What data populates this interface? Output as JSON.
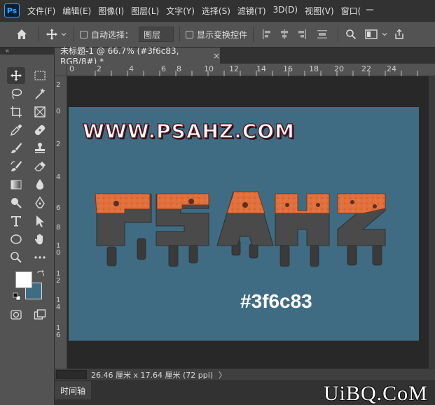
{
  "app": {
    "logo": "Ps"
  },
  "menubar": {
    "items": [
      "文件(F)",
      "编辑(E)",
      "图像(I)",
      "图层(L)",
      "文字(Y)",
      "选择(S)",
      "滤镜(T)",
      "3D(D)",
      "视图(V)",
      "窗口("
    ]
  },
  "options": {
    "auto_select_label": "自动选择：",
    "layer_select_value": "图层",
    "show_transform_label": "显示变换控件"
  },
  "panel_collapse": "«",
  "document": {
    "tab_title": "未标题-1 @ 66.7% (#3f6c83, RGB/8#) *",
    "close_glyph": "×"
  },
  "rulers": {
    "horizontal": [
      "0",
      "2",
      "4",
      "6",
      "8",
      "10",
      "12",
      "14",
      "16",
      "18",
      "20",
      "22",
      "24"
    ],
    "vertical": [
      "2",
      "0",
      "2",
      "4",
      "6",
      "8",
      "1\n0",
      "1\n2",
      "1\n4",
      "1\n6"
    ]
  },
  "canvas": {
    "background_color": "#3f6c83",
    "url_text": "WWW.PSAHZ.COM",
    "art_letters": "PSAHZ",
    "color_label": "#3f6c83"
  },
  "status": {
    "doc_size": "26.46 厘米 x 17.64 厘米 (72 ppi)",
    "arrow": "〉"
  },
  "timeline": {
    "label": "时间轴"
  },
  "watermark": "UiBQ.CoM",
  "icons": {
    "home": "home-icon",
    "move": "move-icon",
    "search": "search-icon",
    "share": "share-icon"
  }
}
